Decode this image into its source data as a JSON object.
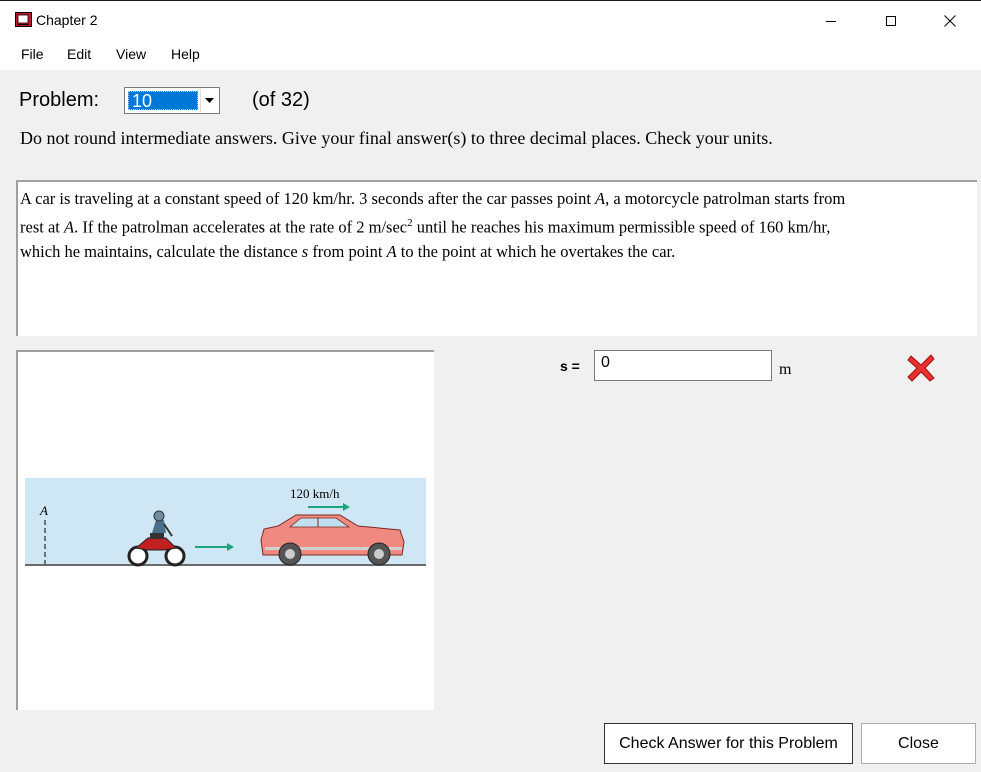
{
  "window": {
    "title": "Chapter 2",
    "minimize_glyph": "—",
    "close_glyph": "✕"
  },
  "menu": {
    "items": [
      "File",
      "Edit",
      "View",
      "Help"
    ]
  },
  "problem": {
    "label": "Problem:",
    "selected": "10",
    "total": "(of 32)"
  },
  "instructions": "Do not round intermediate answers.  Give your final answer(s) to three decimal places.  Check your units.",
  "problem_text": {
    "line1": "A car is traveling at a constant speed of 120 km/hr.  3 seconds after the car passes point ",
    "point1": "A",
    "line1b": ", a motorcycle patrolman starts from",
    "line2a": "rest at ",
    "point2": "A",
    "line2b": ".  If the patrolman accelerates at the rate of 2 m/sec",
    "sup": "2",
    "line2c": " until he reaches his maximum permissible speed of 160 km/hr,",
    "line3a": "which he maintains, calculate the distance ",
    "var_s": "s",
    "line3b": " from point ",
    "point3": "A",
    "line3c": " to the point at which he overtakes the car."
  },
  "figure": {
    "speed_label": "120 km/h",
    "point_label": "A",
    "colors": {
      "sky": "#cfe6f4",
      "car": "#f08a80",
      "arrow": "#1aa67a"
    }
  },
  "answer": {
    "label": "s =",
    "value": "0",
    "unit": "m",
    "status_icon": "wrong-x-icon"
  },
  "buttons": {
    "check": "Check Answer for this Problem",
    "close": "Close"
  }
}
